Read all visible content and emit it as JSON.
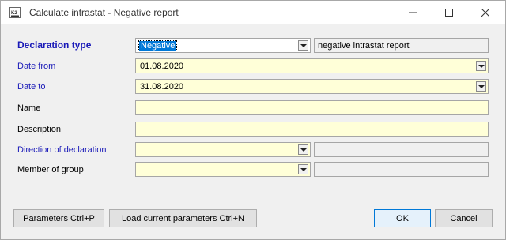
{
  "window": {
    "title": "Calculate intrastat - Negative report",
    "icon": "k2-app-icon"
  },
  "form": {
    "declaration_type": {
      "label": "Declaration type",
      "value": "Negative",
      "description": "negative intrastat report"
    },
    "date_from": {
      "label": "Date from",
      "value": "01.08.2020"
    },
    "date_to": {
      "label": "Date to",
      "value": "31.08.2020"
    },
    "name": {
      "label": "Name",
      "value": ""
    },
    "description": {
      "label": "Description",
      "value": ""
    },
    "direction": {
      "label": "Direction of declaration",
      "value": "",
      "description": ""
    },
    "member_group": {
      "label": "Member of group",
      "value": "",
      "description": ""
    }
  },
  "buttons": {
    "parameters": "Parameters Ctrl+P",
    "load_params": "Load current parameters Ctrl+N",
    "ok": "OK",
    "cancel": "Cancel"
  },
  "colors": {
    "required_label": "#1a1ab8",
    "field_bg": "#ffffd8",
    "selection": "#0078d7"
  }
}
